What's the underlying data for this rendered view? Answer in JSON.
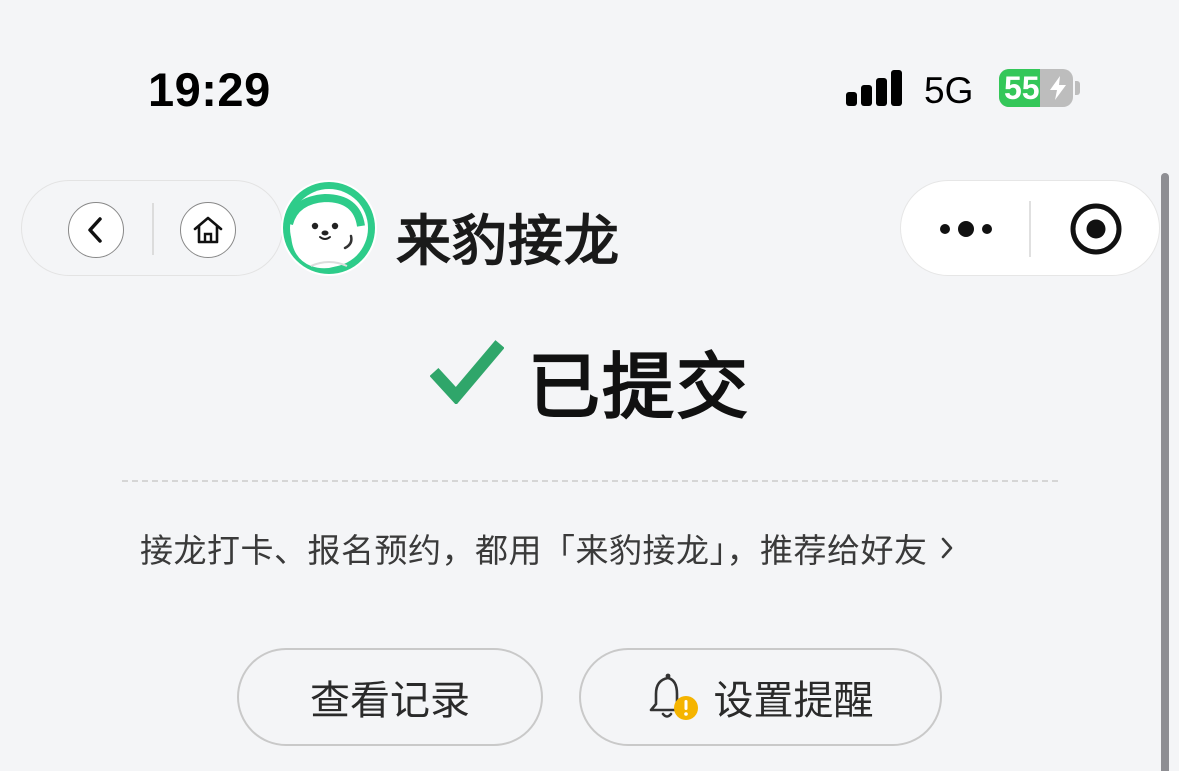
{
  "status_bar": {
    "time": "19:29",
    "network": "5G",
    "battery_level": "55",
    "battery_percent": 55,
    "battery_charging": true,
    "battery_color": "#34c759"
  },
  "nav": {
    "back_icon": "chevron-left-icon",
    "home_icon": "home-icon"
  },
  "header": {
    "app_name": "来豹接龙",
    "logo_icon": "seal-mascot-icon"
  },
  "menu": {
    "more_icon": "more-dots-icon",
    "close_icon": "target-circle-icon"
  },
  "result": {
    "title": "已提交",
    "icon": "checkmark-icon",
    "accent_color": "#2fa66a"
  },
  "recommend": {
    "text": "接龙打卡、报名预约，都用「来豹接龙」，推荐给好友",
    "chevron_icon": "chevron-right-icon"
  },
  "actions": {
    "view_records": "查看记录",
    "set_reminder": "设置提醒",
    "reminder_icon": "bell-warning-icon"
  }
}
